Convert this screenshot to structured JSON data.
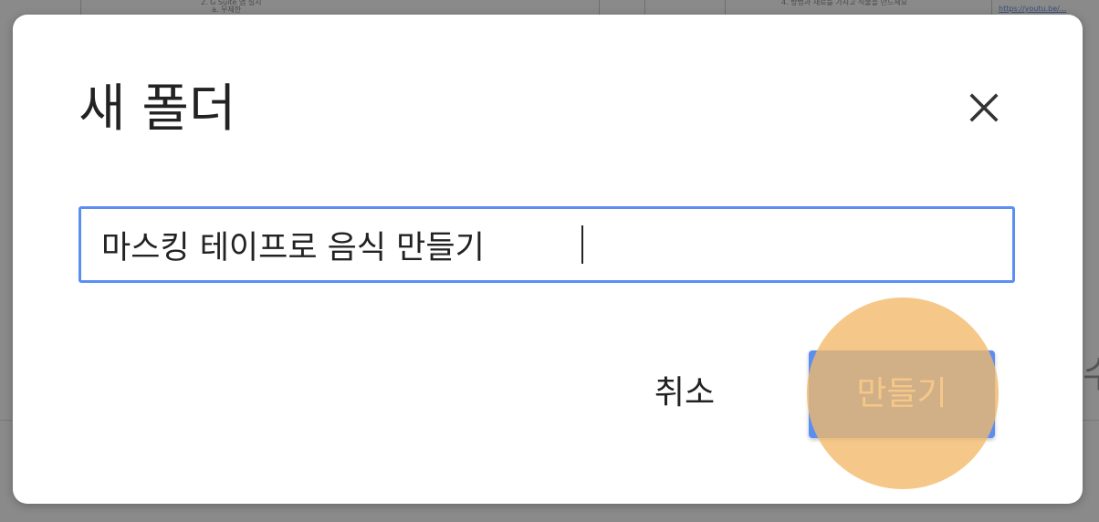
{
  "background": {
    "snippets": [
      "2. G Suite 앱 설치",
      "a. 무제한",
      "4. 방법과 재료를 가지고 식물을 만드세요",
      "https://youtu.be/..."
    ],
    "side_char": "수"
  },
  "dialog": {
    "title": "새 폴더",
    "close_icon": "close-icon",
    "folder_name": {
      "value": "마스킹 테이프로 음식 만들기"
    },
    "cancel_label": "취소",
    "create_label": "만들기"
  },
  "colors": {
    "accent": "#5b8ef2",
    "click_highlight": "#f2b969",
    "backdrop": "#8a8a8a"
  }
}
